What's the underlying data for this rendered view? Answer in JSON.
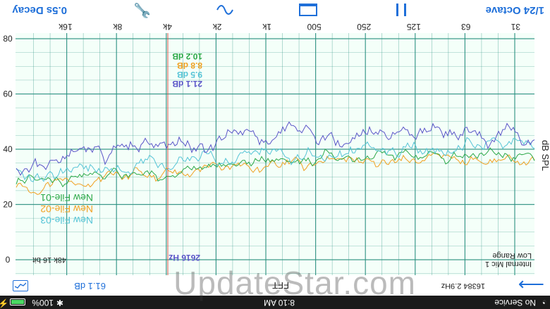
{
  "status_bar": {
    "carrier": "No Service",
    "time": "8:10 AM",
    "battery_percent": "100%",
    "battery_level": 1.0
  },
  "toolbar": {
    "octave": "1/24 Octave",
    "decay": "0.5s Decay",
    "icons": [
      "pause-icon",
      "window-icon",
      "sine-wave-icon",
      "wrench-icon"
    ]
  },
  "fft_bar": {
    "forward_icon": "arrow-right-icon",
    "settings": "16384 2.9Hz",
    "label": "FFT",
    "level": "61.1 dB",
    "graph_icon": "graph-icon"
  },
  "overlay": {
    "mic_line1": "Internal Mic 1",
    "mic_line2": "Low Range",
    "format": "48k 16 bit",
    "cursor_freq": "2616 Hz"
  },
  "freq_axis": {
    "ticks": [
      "31",
      "63",
      "125",
      "250",
      "500",
      "1k",
      "2k",
      "4k",
      "8k",
      "16k"
    ]
  },
  "y_axis": {
    "label": "dB SPL",
    "ticks": [
      "80",
      "60",
      "40",
      "20",
      "0"
    ]
  },
  "legend": {
    "items": [
      "New File-03",
      "New File-02",
      "New File-01"
    ]
  },
  "cursor_readouts": [
    "21.1 dB",
    "9.5 dB",
    "8.8 dB",
    "10.2 dB"
  ],
  "colors": {
    "accent": "#1e6fd9",
    "grid": "#2a8f80",
    "cursor": "#e0574a",
    "file03": "#55c4d6",
    "file02": "#f0a020",
    "file01": "#2ca848",
    "live": "#5a55c8"
  },
  "watermark": "UpdateStar.com"
}
